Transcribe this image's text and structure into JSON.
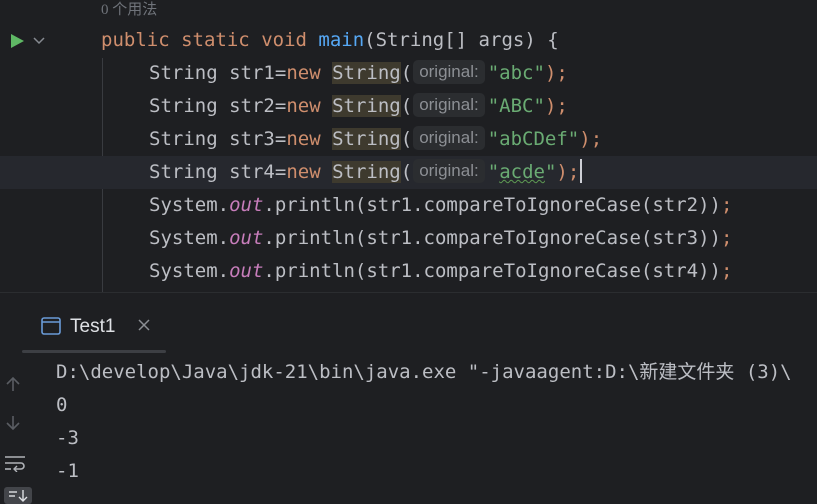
{
  "editor": {
    "usage_hint": "0 个用法",
    "method_signature": {
      "kw_public": "public",
      "kw_static": "static",
      "kw_void": "void",
      "name": "main",
      "params": "(String[] args) {"
    },
    "declarations": [
      {
        "type": "String",
        "var": "str1",
        "eq": "=",
        "kw_new": "new",
        "ctor": "String",
        "open": "(",
        "hint": "original:",
        "value": "\"abc\"",
        "close": ");"
      },
      {
        "type": "String",
        "var": "str2",
        "eq": "=",
        "kw_new": "new",
        "ctor": "String",
        "open": "(",
        "hint": "original:",
        "value": "\"ABC\"",
        "close": ");"
      },
      {
        "type": "String",
        "var": "str3",
        "eq": "=",
        "kw_new": "new",
        "ctor": "String",
        "open": "(",
        "hint": "original:",
        "value": "\"abCDef\"",
        "close": ");"
      },
      {
        "type": "String",
        "var": "str4",
        "eq": "=",
        "kw_new": "new",
        "ctor": "String",
        "open": "(",
        "hint": "original:",
        "quote_open": "\"",
        "value_word": "acde",
        "quote_close": "\"",
        "close": ");"
      }
    ],
    "prints": [
      {
        "cls": "System.",
        "field": "out",
        "call": ".println(str1.compareToIgnoreCase(str2))",
        "semi": ";"
      },
      {
        "cls": "System.",
        "field": "out",
        "call": ".println(str1.compareToIgnoreCase(str3))",
        "semi": ";"
      },
      {
        "cls": "System.",
        "field": "out",
        "call": ".println(str1.compareToIgnoreCase(str4))",
        "semi": ";"
      }
    ],
    "gutter_icons": [
      "run-icon",
      "chevron-down-icon"
    ]
  },
  "run_panel": {
    "tab_label": "Test1",
    "icons": [
      "console-tab-icon",
      "close-icon",
      "arrow-up-icon",
      "arrow-down-icon",
      "soft-wrap-icon",
      "scroll-to-end-icon"
    ],
    "console_lines": [
      "D:\\develop\\Java\\jdk-21\\bin\\java.exe \"-javaagent:D:\\新建文件夹 (3)\\",
      "0",
      "-3",
      "-1"
    ]
  },
  "colors": {
    "background": "#1e1f22",
    "keyword": "#cf8e6d",
    "function": "#56a8f5",
    "string": "#6aab73",
    "static_field": "#c77dbb",
    "text": "#bcbec4",
    "run_green": "#5fb865"
  }
}
